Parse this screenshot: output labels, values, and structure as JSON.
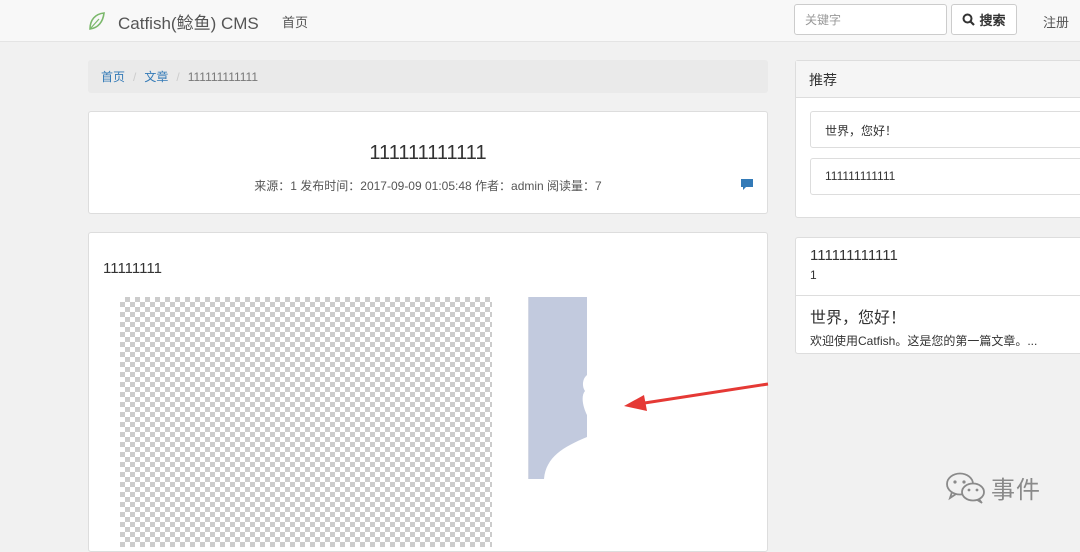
{
  "navbar": {
    "brand": "Catfish(鲶鱼) CMS",
    "home": "首页",
    "search_placeholder": "关键字",
    "search_button": "搜索",
    "register": "注册"
  },
  "breadcrumb": {
    "home": "首页",
    "category": "文章",
    "current": "111111111111"
  },
  "article": {
    "title": "111111111111",
    "meta": "来源：1 发布时间：2017-09-09 01:05:48 作者：admin 阅读量：7",
    "body_text": "11111111"
  },
  "sidebar": {
    "recommend_heading": "推荐",
    "recommend_items": [
      "世界，您好！",
      "111111111111"
    ],
    "latest": [
      {
        "title": "111111111111",
        "excerpt": "1"
      },
      {
        "title": "世界，您好！",
        "excerpt": "欢迎使用Catfish。这是您的第一篇文章。..."
      }
    ]
  },
  "watermark": {
    "text": "事件"
  },
  "colors": {
    "link": "#337ab7",
    "arrow": "#e53935",
    "image_blue": "#c2cade"
  }
}
